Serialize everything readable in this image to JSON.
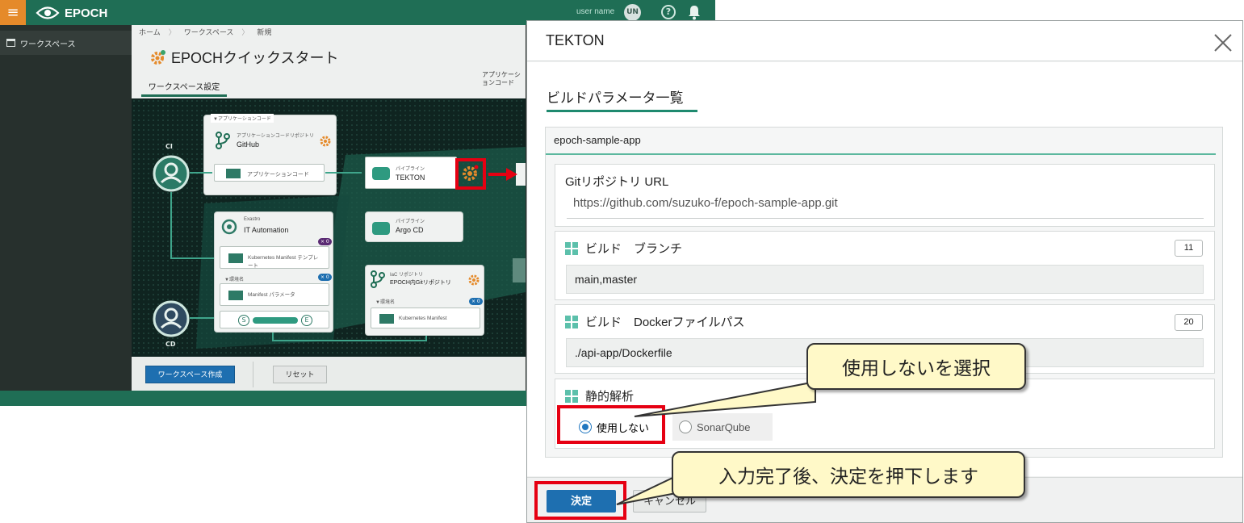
{
  "app": {
    "brand": "EPOCH",
    "user_name": "user name",
    "avatar_initials": "UN",
    "help_glyph": "?",
    "sidebar_item": "ワークスペース",
    "breadcrumb": [
      "ホーム",
      "ワークスペース",
      "新規"
    ],
    "page_title": "EPOCHクイックスタート",
    "tab_label": "ワークスペース設定",
    "tab_app_code": "アプリケーションコード",
    "create_button": "ワークスペース作成",
    "reset_button": "リセット",
    "accent_color": "#1f6e55",
    "canvas": {
      "group_label": "▼アプリケーションコード",
      "ci_label": "CI",
      "cd_label": "CD",
      "repo_small": "アプリケーションコードリポジトリ",
      "repo_name": "GitHub",
      "app_code": "アプリケーションコード",
      "pipeline_small": "パイプライン",
      "tekton": "TEKTON",
      "argo_small": "パイプライン",
      "argo": "Argo CD",
      "exastro_small": "Exastro",
      "ita": "IT Automation",
      "k8s_template": "Kubernetes Manifest テンプレート",
      "env_label": "▼環境名",
      "manifest_params": "Manifest パラメータ",
      "iac_small": "IaC リポジトリ",
      "iac_repo": "EPOCH内Gitリポジトリ",
      "k8s_manifest": "Kubernetes Manifest",
      "s_label": "S",
      "e_label": "E",
      "badge": "× 0"
    }
  },
  "modal": {
    "title": "TEKTON",
    "section_title": "ビルドパラメータ一覧",
    "app_name": "epoch-sample-app",
    "git_label": "Gitリポジトリ URL",
    "git_url": "https://github.com/suzuko-f/epoch-sample-app.git",
    "branch_label": "ビルド　ブランチ",
    "branch_count": "11",
    "branch_value": "main,master",
    "docker_label": "ビルド　Dockerファイルパス",
    "docker_count": "20",
    "docker_value": "./api-app/Dockerfile",
    "static_label": "静的解析",
    "radio_options": [
      "使用しない",
      "SonarQube"
    ],
    "selected_option": "使用しない",
    "decide_button": "決定",
    "cancel_button": "キャンセル"
  },
  "annotations": {
    "callout_select": "使用しないを選択",
    "callout_submit": "入力完了後、決定を押下します",
    "highlight_color": "#e60012",
    "callout_color": "#fff9c8"
  }
}
